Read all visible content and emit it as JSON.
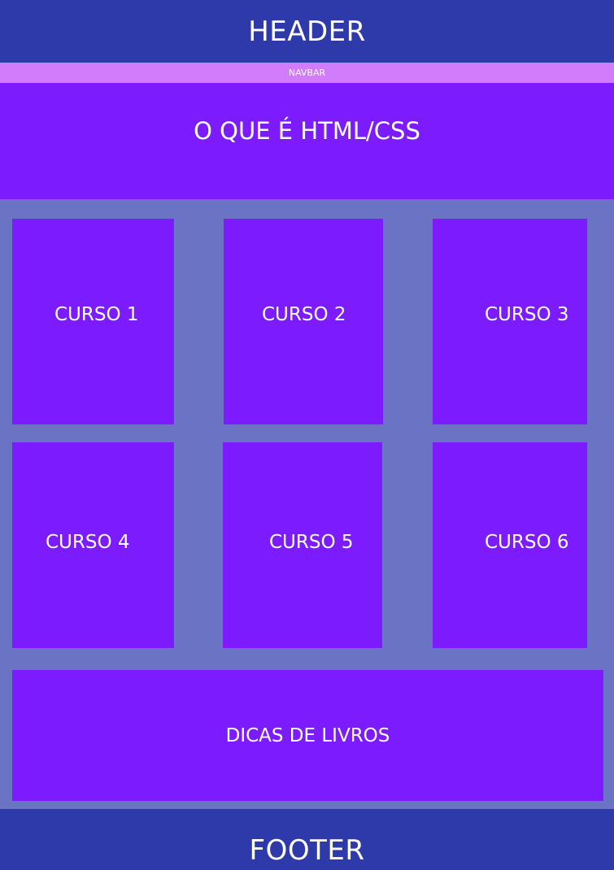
{
  "header": {
    "title": "HEADER"
  },
  "navbar": {
    "label": "NAVBAR"
  },
  "hero": {
    "title": "O QUE É HTML/CSS"
  },
  "courses": {
    "items": [
      {
        "label": "CURSO 1"
      },
      {
        "label": "CURSO 2"
      },
      {
        "label": "CURSO 3"
      },
      {
        "label": "CURSO 4"
      },
      {
        "label": "CURSO 5"
      },
      {
        "label": "CURSO 6"
      }
    ]
  },
  "books": {
    "title": "DICAS DE LIVROS"
  },
  "footer": {
    "title": "FOOTER"
  },
  "colors": {
    "header_bg": "#2e3aaa",
    "navbar_bg": "#d27cfb",
    "card_bg": "#7c1bfe",
    "page_bg": "#6b74c4",
    "text": "#ffffff"
  }
}
